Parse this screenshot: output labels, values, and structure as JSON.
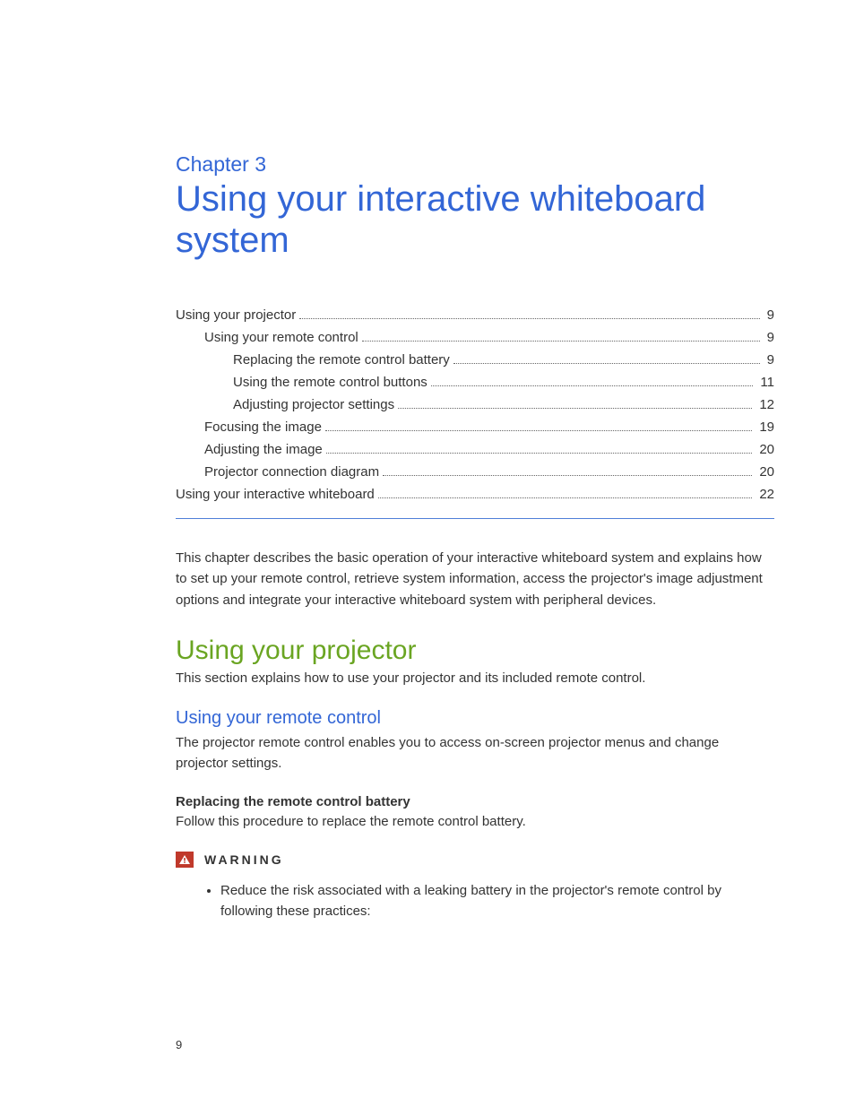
{
  "chapter_label": "Chapter 3",
  "chapter_title": "Using your interactive whiteboard system",
  "toc": [
    {
      "text": "Using your projector",
      "page": "9",
      "indent": 0
    },
    {
      "text": "Using your remote control",
      "page": "9",
      "indent": 1
    },
    {
      "text": "Replacing the remote control battery",
      "page": "9",
      "indent": 2
    },
    {
      "text": "Using the remote control buttons",
      "page": "11",
      "indent": 2
    },
    {
      "text": "Adjusting projector settings",
      "page": "12",
      "indent": 2
    },
    {
      "text": "Focusing the image",
      "page": "19",
      "indent": 1
    },
    {
      "text": "Adjusting the image",
      "page": "20",
      "indent": 1
    },
    {
      "text": "Projector connection diagram",
      "page": "20",
      "indent": 1
    },
    {
      "text": "Using your interactive whiteboard",
      "page": "22",
      "indent": 0
    }
  ],
  "intro_paragraph": "This chapter describes the basic operation of your interactive whiteboard system and explains how to set up your remote control, retrieve system information, access the projector's image adjustment options and integrate your interactive whiteboard system with peripheral devices.",
  "section1": {
    "heading": "Using your projector",
    "text": "This section explains how to use your projector and its included remote control."
  },
  "sub1": {
    "heading": "Using your remote control",
    "text": "The projector remote control enables you to access on-screen projector menus and change projector settings."
  },
  "bold1": {
    "heading": "Replacing the remote control battery",
    "text": "Follow this procedure to replace the remote control battery."
  },
  "warning": {
    "label": "WARNING",
    "bullet": "Reduce the risk associated with a leaking battery in the projector's remote control by following these practices:"
  },
  "page_number": "9"
}
